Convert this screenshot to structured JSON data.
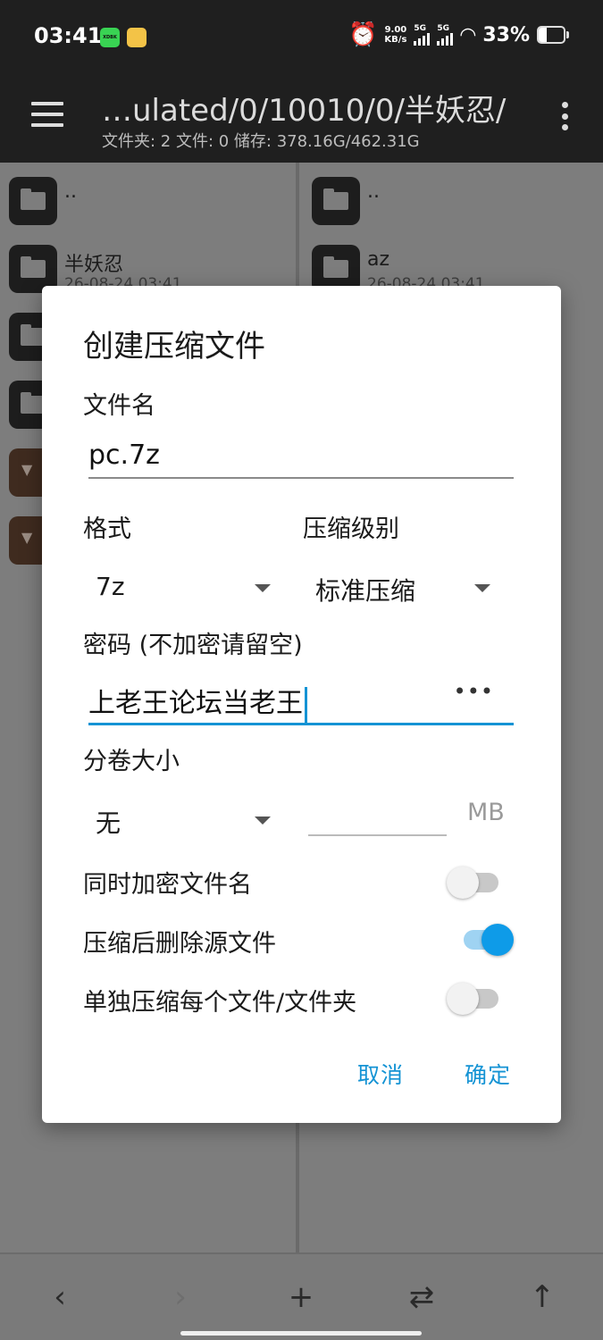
{
  "status_bar": {
    "time": "03:41",
    "app_icon1_text": "XDBK",
    "speed_value": "9.00",
    "speed_unit": "KB/s",
    "signal1_label": "5G",
    "signal2_label": "5G",
    "battery_percent_text": "33%",
    "battery_level": 0.33
  },
  "toolbar": {
    "path_title": "…ulated/0/10010/0/半妖忍/",
    "path_info": "文件夹: 2  文件: 0  储存: 378.16G/462.31G"
  },
  "left_pane": {
    "items": [
      {
        "name": "..",
        "date": ""
      },
      {
        "name": "半妖忍",
        "date": "26-08-24 03:41"
      }
    ]
  },
  "right_pane": {
    "items": [
      {
        "name": "..",
        "date": ""
      },
      {
        "name": "az",
        "date": "26-08-24 03:41"
      }
    ]
  },
  "dialog": {
    "title": "创建压缩文件",
    "filename_label": "文件名",
    "filename_value": "pc.7z",
    "format_label": "格式",
    "format_value": "7z",
    "level_label": "压缩级别",
    "level_value": "标准压缩",
    "password_label": "密码 (不加密请留空)",
    "password_value": "上老王论坛当老王",
    "password_toggle": "•••",
    "volume_label": "分卷大小",
    "volume_value": "无",
    "volume_size_value": "",
    "volume_unit": "MB",
    "encrypt_names_label": "同时加密文件名",
    "encrypt_names_on": false,
    "delete_source_label": "压缩后删除源文件",
    "delete_source_on": true,
    "separate_label": "单独压缩每个文件/文件夹",
    "separate_on": false,
    "cancel_label": "取消",
    "ok_label": "确定"
  },
  "bottom_nav": {
    "back_icon": "‹",
    "forward_icon": "›",
    "add_icon": "+",
    "swap_icon": "⇄",
    "up_icon": "↑"
  }
}
